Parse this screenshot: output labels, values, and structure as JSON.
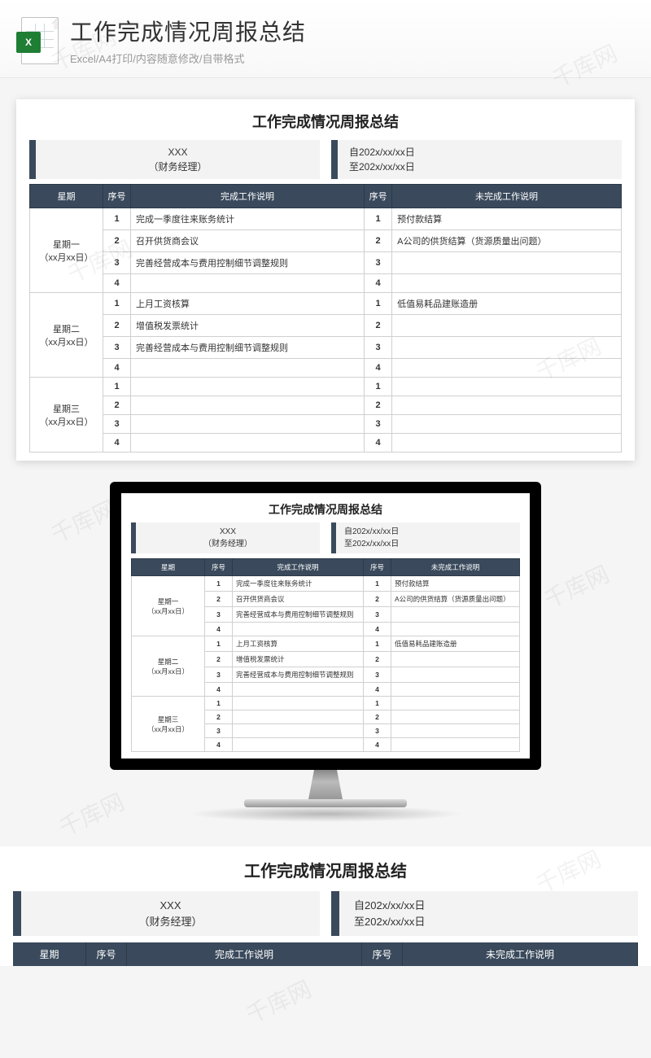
{
  "banner": {
    "title": "工作完成情况周报总结",
    "subtitle": "Excel/A4打印/内容随意修改/自带格式",
    "icon_badge": "X"
  },
  "report": {
    "title": "工作完成情况周报总结",
    "info_left_line1": "XXX",
    "info_left_line2": "（财务经理）",
    "info_right_line1": "自202x/xx/xx日",
    "info_right_line2": "至202x/xx/xx日",
    "headers": {
      "day": "星期",
      "idx1": "序号",
      "done": "完成工作说明",
      "idx2": "序号",
      "undone": "未完成工作说明"
    },
    "days": [
      {
        "label_line1": "星期一",
        "label_line2": "（xx月xx日）",
        "rows": [
          {
            "n": "1",
            "done": "完成一季度往来账务统计",
            "undone": "预付款结算"
          },
          {
            "n": "2",
            "done": "召开供货商会议",
            "undone": "A公司的供货结算（货源质量出问题）"
          },
          {
            "n": "3",
            "done": "完善经营成本与费用控制细节调整规则",
            "undone": ""
          },
          {
            "n": "4",
            "done": "",
            "undone": ""
          }
        ]
      },
      {
        "label_line1": "星期二",
        "label_line2": "（xx月xx日）",
        "rows": [
          {
            "n": "1",
            "done": "上月工资核算",
            "undone": "低值易耗品建账造册"
          },
          {
            "n": "2",
            "done": "增值税发票统计",
            "undone": ""
          },
          {
            "n": "3",
            "done": "完善经营成本与费用控制细节调整规则",
            "undone": ""
          },
          {
            "n": "4",
            "done": "",
            "undone": ""
          }
        ]
      },
      {
        "label_line1": "星期三",
        "label_line2": "（xx月xx日）",
        "rows": [
          {
            "n": "1",
            "done": "",
            "undone": ""
          },
          {
            "n": "2",
            "done": "",
            "undone": ""
          },
          {
            "n": "3",
            "done": "",
            "undone": ""
          },
          {
            "n": "4",
            "done": "",
            "undone": ""
          }
        ]
      }
    ]
  },
  "watermark": "千库网"
}
